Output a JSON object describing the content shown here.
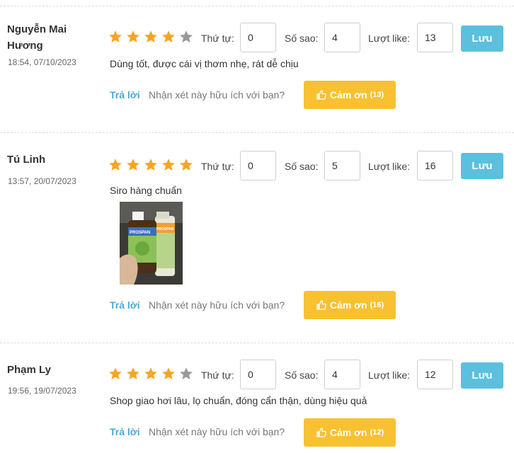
{
  "labels": {
    "order": "Thứ tự:",
    "stars": "Số sao:",
    "likes": "Lượt like:",
    "save": "Lưu",
    "reply": "Trả lời",
    "helpful": "Nhận xét này hữu ích với bạn?",
    "thanks": "Cảm ơn"
  },
  "colors": {
    "star_on": "#f5a623",
    "star_off": "#999999",
    "save_btn": "#5bc0de",
    "thanks_btn": "#f7c130",
    "reply_link": "#4aa8d8"
  },
  "icons": {
    "star": "star-icon",
    "thumb": "thumbs-up-icon"
  },
  "reviews": [
    {
      "author": "Nguyễn Mai Hương",
      "date": "18:54, 07/10/2023",
      "rating": 4,
      "order": "0",
      "stars_value": "4",
      "likes": "13",
      "content": "Dùng tốt, được cái vị thơm nhẹ, rát dễ chịu",
      "thanks_count": "(13)"
    },
    {
      "author": "Tú Linh",
      "date": "13:57, 20/07/2023",
      "rating": 5,
      "order": "0",
      "stars_value": "5",
      "likes": "16",
      "content": "Siro hàng chuẩn",
      "thanks_count": "(16)",
      "photo": {
        "bottle_label_1": "PROSPAN",
        "bottle_label_2": "PROSPAN"
      }
    },
    {
      "author": "Phạm Ly",
      "date": "19:56, 19/07/2023",
      "rating": 4,
      "order": "0",
      "stars_value": "4",
      "likes": "12",
      "content": "Shop giao hơi lâu, lọ chuẩn, đóng cẩn thận, dùng hiệu quả",
      "thanks_count": "(12)"
    }
  ]
}
